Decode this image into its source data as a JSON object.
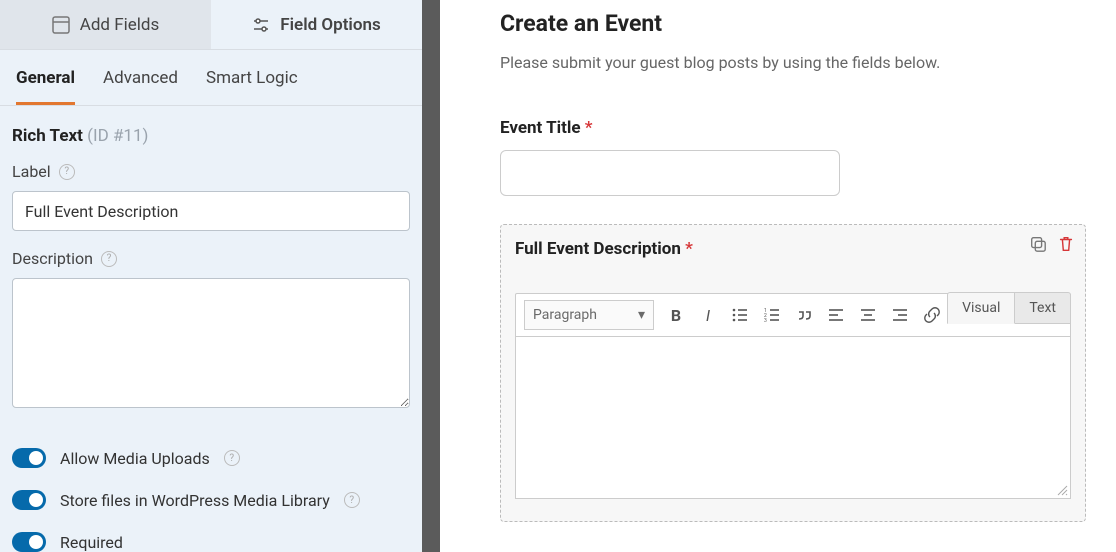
{
  "sidebar": {
    "topTabs": {
      "addFields": "Add Fields",
      "fieldOptions": "Field Options"
    },
    "subTabs": {
      "general": "General",
      "advanced": "Advanced",
      "smartLogic": "Smart Logic"
    },
    "fieldHeader": {
      "type": "Rich Text",
      "idLabel": "(ID #11)"
    },
    "labelLabel": "Label",
    "labelValue": "Full Event Description",
    "descriptionLabel": "Description",
    "descriptionValue": "",
    "toggles": {
      "allowMedia": "Allow Media Uploads",
      "storeFiles": "Store files in WordPress Media Library",
      "required": "Required"
    }
  },
  "main": {
    "title": "Create an Event",
    "intro": "Please submit your guest blog posts by using the fields below.",
    "eventTitle": {
      "label": "Event Title"
    },
    "fullDesc": {
      "label": "Full Event Description"
    },
    "editor": {
      "visualTab": "Visual",
      "textTab": "Text",
      "format": "Paragraph"
    }
  }
}
